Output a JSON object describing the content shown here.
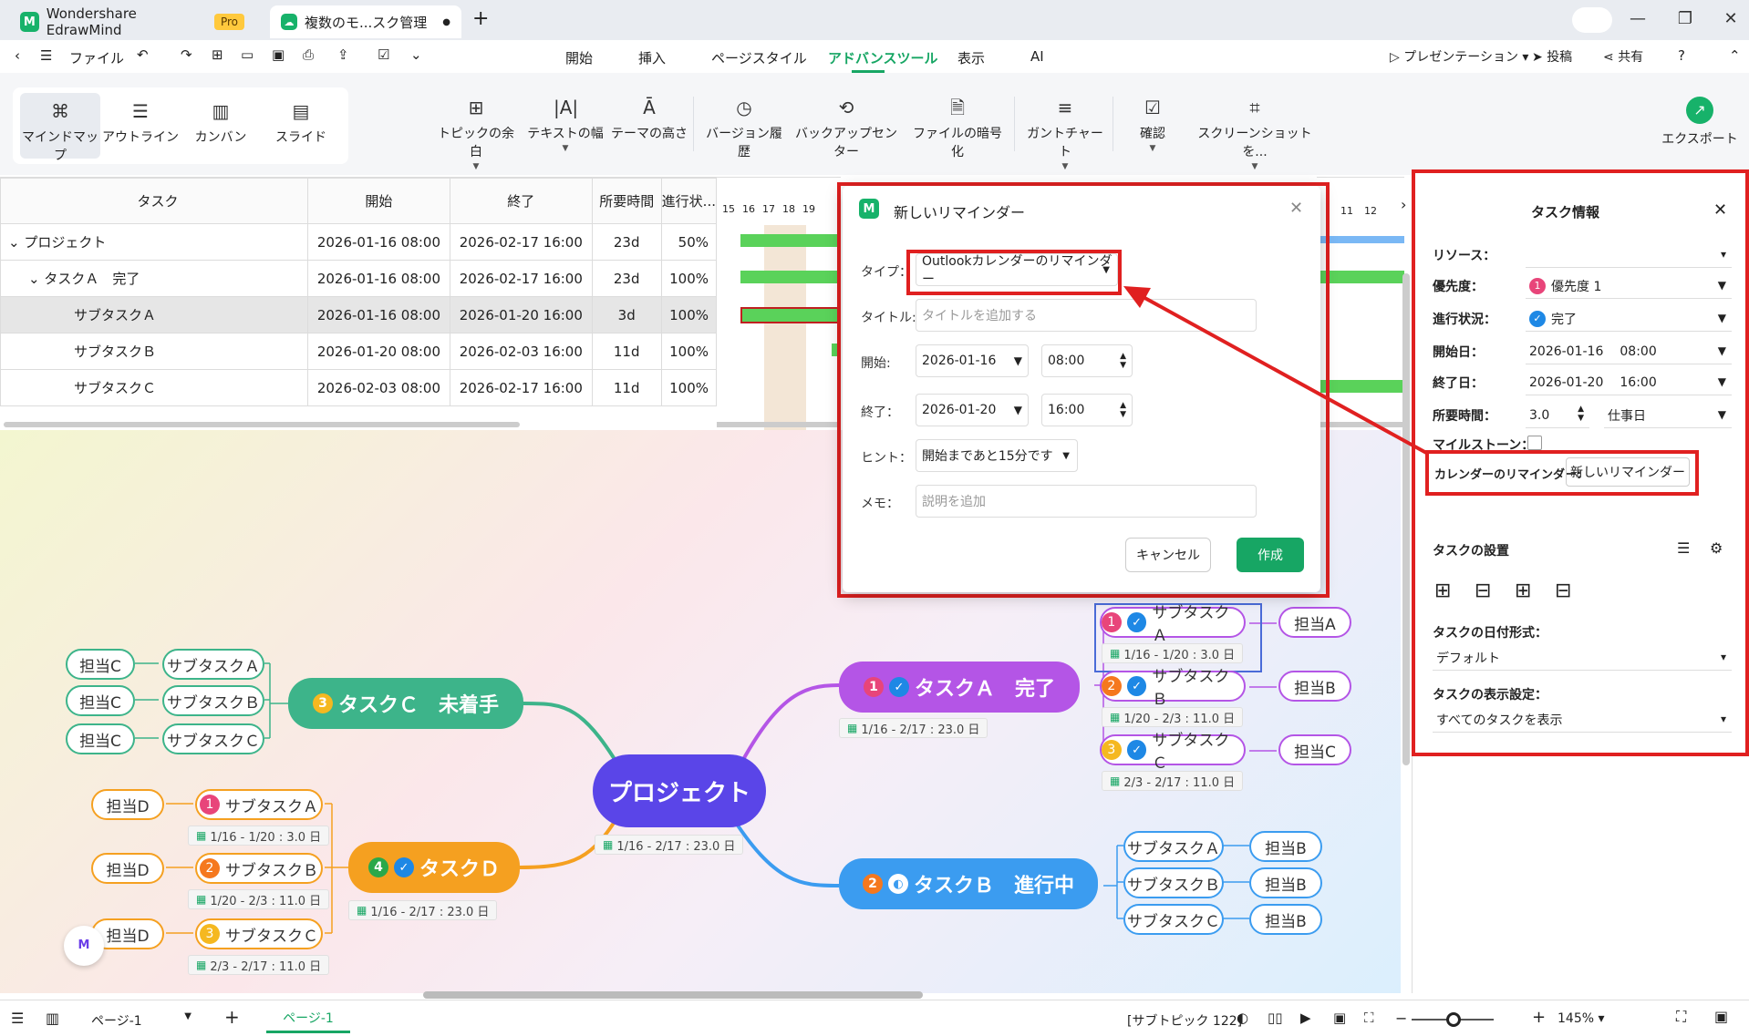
{
  "titlebar": {
    "app_name": "Wondershare EdrawMind",
    "pro_badge": "Pro",
    "doc_tab": "複数のモ...スク管理"
  },
  "menubar": {
    "file": "ファイル",
    "tabs": [
      "開始",
      "挿入",
      "ページスタイル",
      "アドバンスツール",
      "表示",
      "AI"
    ],
    "active_tab": "アドバンスツール",
    "presentation": "プレゼンテーション",
    "post": "投稿",
    "share": "共有"
  },
  "ribbon": {
    "views": [
      "マインドマップ",
      "アウトライン",
      "カンバン",
      "スライド"
    ],
    "tools": [
      "トピックの余白",
      "テキストの幅",
      "テーマの高さ",
      "バージョン履歴",
      "バックアップセンター",
      "ファイルの暗号化",
      "ガントチャート",
      "確認",
      "スクリーンショットを...",
      "エクスポート"
    ]
  },
  "gantt": {
    "headers": [
      "タスク",
      "開始",
      "終了",
      "所要時間",
      "進行状..."
    ],
    "rows": [
      {
        "task": "プロジェクト",
        "start": "2026-01-16 08:00",
        "end": "2026-02-17 16:00",
        "dur": "23d",
        "prog": "50%"
      },
      {
        "task": "タスクＡ　完了",
        "start": "2026-01-16 08:00",
        "end": "2026-02-17 16:00",
        "dur": "23d",
        "prog": "100%"
      },
      {
        "task": "サブタスクＡ",
        "start": "2026-01-16 08:00",
        "end": "2026-01-20 16:00",
        "dur": "3d",
        "prog": "100%"
      },
      {
        "task": "サブタスクＢ",
        "start": "2026-01-20 08:00",
        "end": "2026-02-03 16:00",
        "dur": "11d",
        "prog": "100%"
      },
      {
        "task": "サブタスクＣ",
        "start": "2026-02-03 08:00",
        "end": "2026-02-17 16:00",
        "dur": "11d",
        "prog": "100%"
      }
    ],
    "day_ticks": [
      "15",
      "16",
      "17",
      "18",
      "19"
    ],
    "day_ticks_right": [
      "11",
      "12"
    ]
  },
  "dialog": {
    "title": "新しいリマインダー",
    "type_label": "タイプ：",
    "type_value": "Outlookカレンダーのリマインダー",
    "title_label": "タイトル:",
    "title_placeholder": "タイトルを追加する",
    "start_label": "開始:",
    "start_date": "2026-01-16",
    "start_time": "08:00",
    "end_label": "終了：",
    "end_date": "2026-01-20",
    "end_time": "16:00",
    "hint_label": "ヒント：",
    "hint_value": "開始まであと15分です",
    "memo_label": "メモ：",
    "memo_placeholder": "説明を追加",
    "cancel": "キャンセル",
    "create": "作成"
  },
  "panel": {
    "title": "タスク情報",
    "resource_label": "リソース：",
    "priority_label": "優先度：",
    "priority_value": "優先度 1",
    "progress_label": "進行状況：",
    "progress_value": "完了",
    "start_label": "開始日：",
    "start_date": "2026-01-16",
    "start_time": "08:00",
    "end_label": "終了日：",
    "end_date": "2026-01-20",
    "end_time": "16:00",
    "duration_label": "所要時間：",
    "duration_value": "3.0",
    "duration_unit": "仕事日",
    "milestone_label": "マイルストーン：",
    "reminder_label": "カレンダーのリマインダー:",
    "reminder_button": "新しいリマインダー",
    "settings_title": "タスクの設置",
    "date_format_label": "タスクの日付形式：",
    "date_format_value": "デフォルト",
    "display_label": "タスクの表示設定：",
    "display_value": "すべてのタスクを表示"
  },
  "mindmap": {
    "center": "プロジェクト",
    "center_date": "1/16 - 2/17 : 23.0 日",
    "task_a": "タスクＡ　完了",
    "task_a_date": "1/16 - 2/17 : 23.0 日",
    "task_b": "タスクＢ　進行中",
    "task_c": "タスクＣ　未着手",
    "task_d": "タスクＤ",
    "task_d_date": "1/16 - 2/17 : 23.0 日",
    "sub_a": "サブタスクＡ",
    "sub_b": "サブタスクＢ",
    "sub_c": "サブタスクＣ",
    "date_a": "1/16 - 1/20 : 3.0 日",
    "date_b": "1/20 - 2/3 : 11.0 日",
    "date_c": "2/3 - 2/17 : 11.0 日",
    "owner_a": "担当A",
    "owner_b": "担当B",
    "owner_c": "担当C",
    "owner_d": "担当D",
    "badges": [
      "1",
      "2",
      "3",
      "4"
    ]
  },
  "statusbar": {
    "page_select": "ページ-1",
    "page_tab": "ページ-1",
    "subtopic_count": "[サブトピック 122]",
    "zoom": "145%"
  },
  "colors": {
    "accent": "#17a664",
    "red_highlight": "#e02020",
    "purple": "#b455e6",
    "blue": "#3b9cf0",
    "green": "#3db48a",
    "orange": "#f5a020",
    "center": "#5a45e8"
  }
}
